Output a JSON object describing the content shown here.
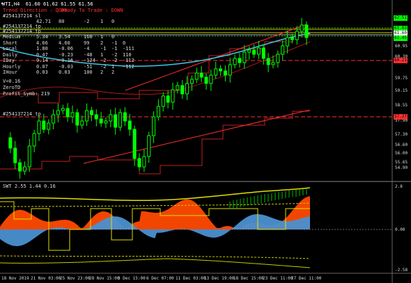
{
  "chart_title": "WTI,H4  61.60 61.62 61.55 61.56",
  "panel_text": {
    "trend_direction": "Trend Direction : DOWN",
    "ready_to_trade": "Ready To Trade : DOWN",
    "order_lines": [
      "#254137214 sl",
      "#254137214 tp",
      "#254137214 tp"
    ],
    "header_row": [
      "",
      "42.71",
      "80",
      "-2",
      "1",
      "0"
    ],
    "rows": [
      [
        "Medium",
        "5.34",
        "3.54",
        "168",
        "1",
        "0",
        ""
      ],
      [
        "Short",
        "4.66",
        "4.60",
        "99",
        "2",
        "-1",
        "0"
      ],
      [
        "Local",
        "1.80",
        "-0.06",
        "-4",
        "-1",
        "-1",
        "-111"
      ],
      [
        "Daily",
        "0.47",
        "-0.23",
        "-48",
        "1",
        "-2",
        "110"
      ],
      [
        "IDay",
        "0.14",
        "-0.16",
        "-124",
        "-2",
        "-2",
        "-112"
      ],
      [
        "Hourly",
        "0.07",
        "-0.03",
        "-51",
        "-2",
        "1",
        "-112"
      ],
      [
        "IHour",
        "0.03",
        "0.03",
        "100",
        "2",
        "2",
        ""
      ]
    ],
    "v_line": "V=0.16",
    "zero_line": "ZeroTD",
    "profit_line": "Profit_Symb: 219",
    "order_tp_label": "#254137214 tp"
  },
  "price_tags": [
    {
      "value": "62.51",
      "color": "#00ff00"
    },
    {
      "value": "61.83",
      "color": "#00ff00"
    },
    {
      "value": "61.60",
      "color": "#ffffff"
    },
    {
      "value": "61.45",
      "color": "#00ff00"
    },
    {
      "value": "60.21",
      "color": "#ff3030"
    },
    {
      "value": "57.27",
      "color": "#ff3030"
    }
  ],
  "price_axis": [
    "60.95",
    "60.30",
    "59.75",
    "59.15",
    "58.55",
    "57.90",
    "57.30",
    "56.60",
    "56.00",
    "55.65",
    "54.90"
  ],
  "osc_title": "SWT 2.55 1.44 0.16",
  "osc_axis": [
    "2.8",
    "0.00",
    "-2.58"
  ],
  "time_axis": [
    "18 Nov 2019",
    "21 Nov 03:00",
    "25 Nov 23:00",
    "28 Nov 15:00",
    "3 Dec 15:00",
    "6 Dec 07:00",
    "11 Dec 03:00",
    "13 Dec 19:00",
    "18 Dec 15:00",
    "23 Dec 11:00",
    "27 Dec 11:00"
  ],
  "chart_data": {
    "type": "candlestick",
    "symbol": "WTI",
    "timeframe": "H4",
    "ohlc_last": {
      "open": 61.6,
      "high": 61.62,
      "low": 61.55,
      "close": 61.56
    },
    "closes": [
      56.8,
      56.3,
      55.6,
      55.2,
      55.4,
      56.4,
      57.0,
      57.6,
      57.2,
      57.5,
      57.9,
      58.1,
      58.2,
      57.8,
      58.0,
      57.4,
      57.6,
      58.1,
      57.9,
      57.7,
      57.5,
      57.6,
      57.9,
      57.3,
      58.0,
      57.6,
      57.2,
      55.8,
      55.4,
      55.9,
      56.9,
      57.8,
      58.3,
      58.8,
      58.5,
      59.1,
      59.3,
      58.9,
      59.4,
      59.6,
      59.9,
      59.7,
      59.4,
      59.8,
      60.1,
      60.0,
      59.8,
      60.3,
      60.6,
      60.4,
      60.9,
      61.0,
      60.8,
      61.1,
      60.6,
      60.3,
      60.4,
      60.8,
      61.2,
      61.6,
      61.5,
      61.9,
      62.2,
      61.6
    ]
  },
  "colors": {
    "background": "#000000",
    "bull": "#00ff00",
    "bear": "#ff3030",
    "ma_cyan": "#40c8e8",
    "trend_red": "#ff3030",
    "osc_orange": "#ff4a00",
    "osc_blue": "#4a90d0",
    "osc_yellow": "#e0e000"
  }
}
